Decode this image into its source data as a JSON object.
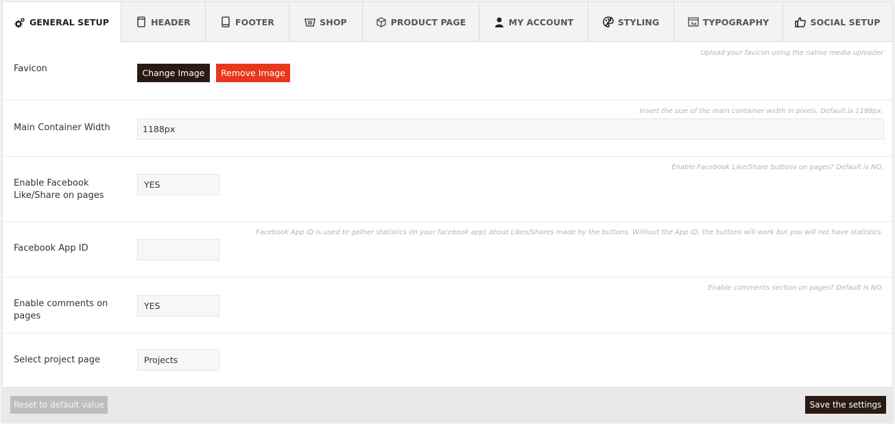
{
  "tabs": [
    {
      "label": "GENERAL SETUP",
      "icon": "gears-icon",
      "active": true
    },
    {
      "label": "HEADER",
      "icon": "tablet-icon"
    },
    {
      "label": "FOOTER",
      "icon": "mobile-icon"
    },
    {
      "label": "SHOP",
      "icon": "basket-icon"
    },
    {
      "label": "PRODUCT PAGE",
      "icon": "box-icon"
    },
    {
      "label": "MY ACCOUNT",
      "icon": "user-icon"
    },
    {
      "label": "STYLING",
      "icon": "palette-icon"
    },
    {
      "label": "TYPOGRAPHY",
      "icon": "font-icon"
    },
    {
      "label": "SOCIAL SETUP",
      "icon": "thumbs-up-icon"
    }
  ],
  "settings": {
    "favicon": {
      "label": "Favicon",
      "hint": "Upload your favicon using the native media uploader",
      "change_label": "Change Image",
      "remove_label": "Remove Image"
    },
    "container_width": {
      "label": "Main Container Width",
      "hint": "Insert the size of the main container width in pixels. Default is 1188px.",
      "value": "1188px"
    },
    "facebook_like": {
      "label": "Enable Facebook Like/Share on pages",
      "hint": "Enable Facebook Like/Share buttons on pages? Default is NO.",
      "value": "YES"
    },
    "facebook_app_id": {
      "label": "Facebook App ID",
      "hint": "Facebook App ID is used to gather statistics (in your facebook app) about Likes/Shares made by the buttons. Without the App ID, the buttons will work but you will not have statistics.",
      "value": ""
    },
    "comments": {
      "label": "Enable comments on pages",
      "hint": "Enable comments section on pages? Default is NO.",
      "value": "YES"
    },
    "project_page": {
      "label": "Select project page",
      "value": "Projects"
    }
  },
  "footer": {
    "reset_label": "Reset to default value",
    "save_label": "Save the settings"
  },
  "colors": {
    "dark_button": "#2b1a14",
    "remove_button": "#e8371c",
    "reset_button": "#bdbdbd"
  }
}
